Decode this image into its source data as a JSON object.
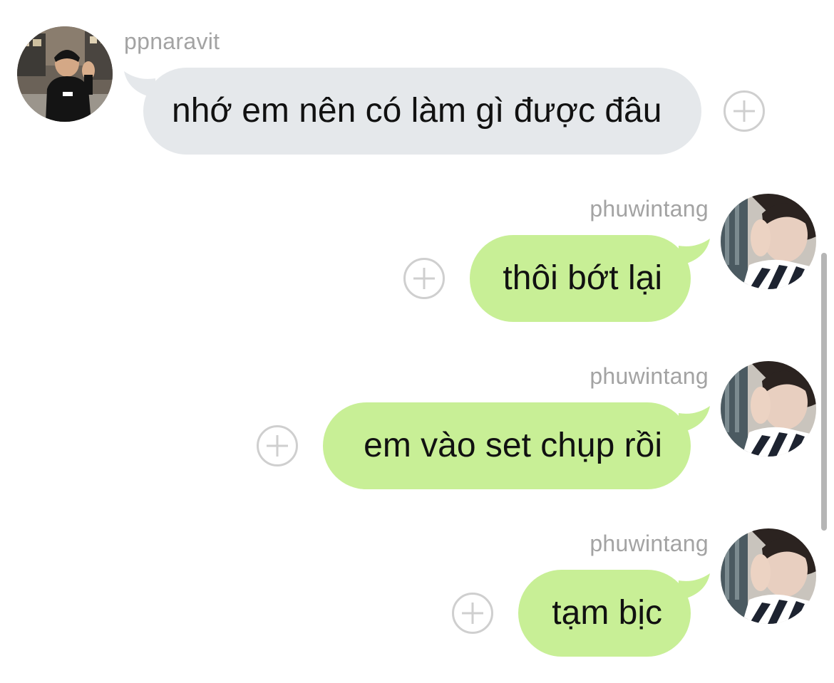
{
  "messages": [
    {
      "sender": "ppnaravit",
      "direction": "incoming",
      "text": "nhớ em nên có làm gì được đâu",
      "avatar_icon": "avatar-ppnaravit",
      "bubble_color": "#e5e8eb"
    },
    {
      "sender": "phuwintang",
      "direction": "outgoing",
      "text": "thôi bớt lại",
      "avatar_icon": "avatar-phuwintang",
      "bubble_color": "#c8ef96"
    },
    {
      "sender": "phuwintang",
      "direction": "outgoing",
      "text": "em vào set chụp rồi",
      "avatar_icon": "avatar-phuwintang",
      "bubble_color": "#c8ef96"
    },
    {
      "sender": "phuwintang",
      "direction": "outgoing",
      "text": "tạm bịc",
      "avatar_icon": "avatar-phuwintang",
      "bubble_color": "#c8ef96"
    }
  ],
  "reaction_icon": "plus-circle-icon"
}
